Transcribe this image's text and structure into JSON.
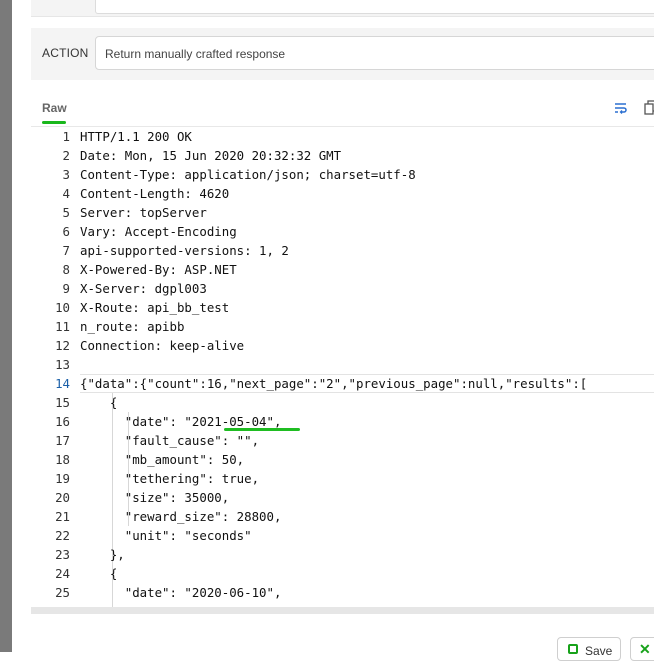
{
  "action": {
    "label": "ACTION",
    "value": "Return manually crafted response"
  },
  "tabs": [
    {
      "label": "Raw",
      "active": true
    }
  ],
  "toolbar": {
    "wrap_icon": "wrap-lines-icon",
    "copy_icon": "copy-icon"
  },
  "editor": {
    "lines": [
      {
        "n": "1",
        "text": "HTTP/1.1 200 OK"
      },
      {
        "n": "2",
        "text": "Date: Mon, 15 Jun 2020 20:32:32 GMT"
      },
      {
        "n": "3",
        "text": "Content-Type: application/json; charset=utf-8"
      },
      {
        "n": "4",
        "text": "Content-Length: 4620"
      },
      {
        "n": "5",
        "text": "Server: topServer"
      },
      {
        "n": "6",
        "text": "Vary: Accept-Encoding"
      },
      {
        "n": "7",
        "text": "api-supported-versions: 1, 2"
      },
      {
        "n": "8",
        "text": "X-Powered-By: ASP.NET"
      },
      {
        "n": "9",
        "text": "X-Server: dgpl003"
      },
      {
        "n": "10",
        "text": "X-Route: api_bb_test"
      },
      {
        "n": "11",
        "text": "n_route: apibb"
      },
      {
        "n": "12",
        "text": "Connection: keep-alive"
      },
      {
        "n": "13",
        "text": ""
      },
      {
        "n": "14",
        "text": "{\"data\":{\"count\":16,\"next_page\":\"2\",\"previous_page\":null,\"results\":["
      },
      {
        "n": "15",
        "text": "    {"
      },
      {
        "n": "16",
        "text": "      \"date\": \"2021-05-04\","
      },
      {
        "n": "17",
        "text": "      \"fault_cause\": \"\","
      },
      {
        "n": "18",
        "text": "      \"mb_amount\": 50,"
      },
      {
        "n": "19",
        "text": "      \"tethering\": true,"
      },
      {
        "n": "20",
        "text": "      \"size\": 35000,"
      },
      {
        "n": "21",
        "text": "      \"reward_size\": 28800,"
      },
      {
        "n": "22",
        "text": "      \"unit\": \"seconds\""
      },
      {
        "n": "23",
        "text": "    },"
      },
      {
        "n": "24",
        "text": "    {"
      },
      {
        "n": "25",
        "text": "      \"date\": \"2020-06-10\","
      }
    ],
    "active_line": 14
  },
  "buttons": {
    "save_label": "Save"
  },
  "colors": {
    "accent": "#19b71c",
    "line_number": "#333333",
    "active_line_number": "#1a5fa8"
  }
}
